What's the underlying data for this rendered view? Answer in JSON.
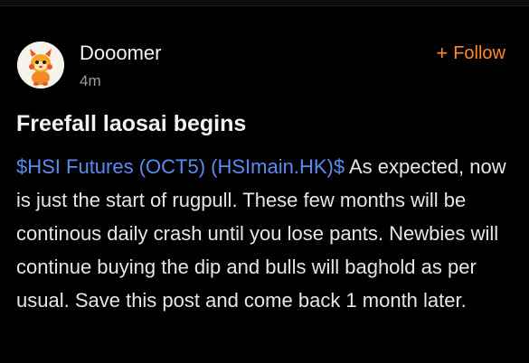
{
  "post": {
    "author": {
      "name": "Dooomer",
      "time": "4m",
      "avatar_icon": "lion-dance-mascot-icon"
    },
    "follow_label": "Follow",
    "title": "Freefall laosai begins",
    "ticker": "$HSI Futures (OCT5) (HSImain.HK)$",
    "body": " As expected, now is just the start of rugpull. These few months will be continous daily crash until you lose pants. Newbies will continue buying the dip and bulls will baghold as per usual. Save this post and come back 1 month later."
  },
  "colors": {
    "background": "#000000",
    "accent_follow": "#ff8a2a",
    "ticker_link": "#5b8bf2",
    "text": "#f2f2f2",
    "muted": "#9a9a9a"
  }
}
